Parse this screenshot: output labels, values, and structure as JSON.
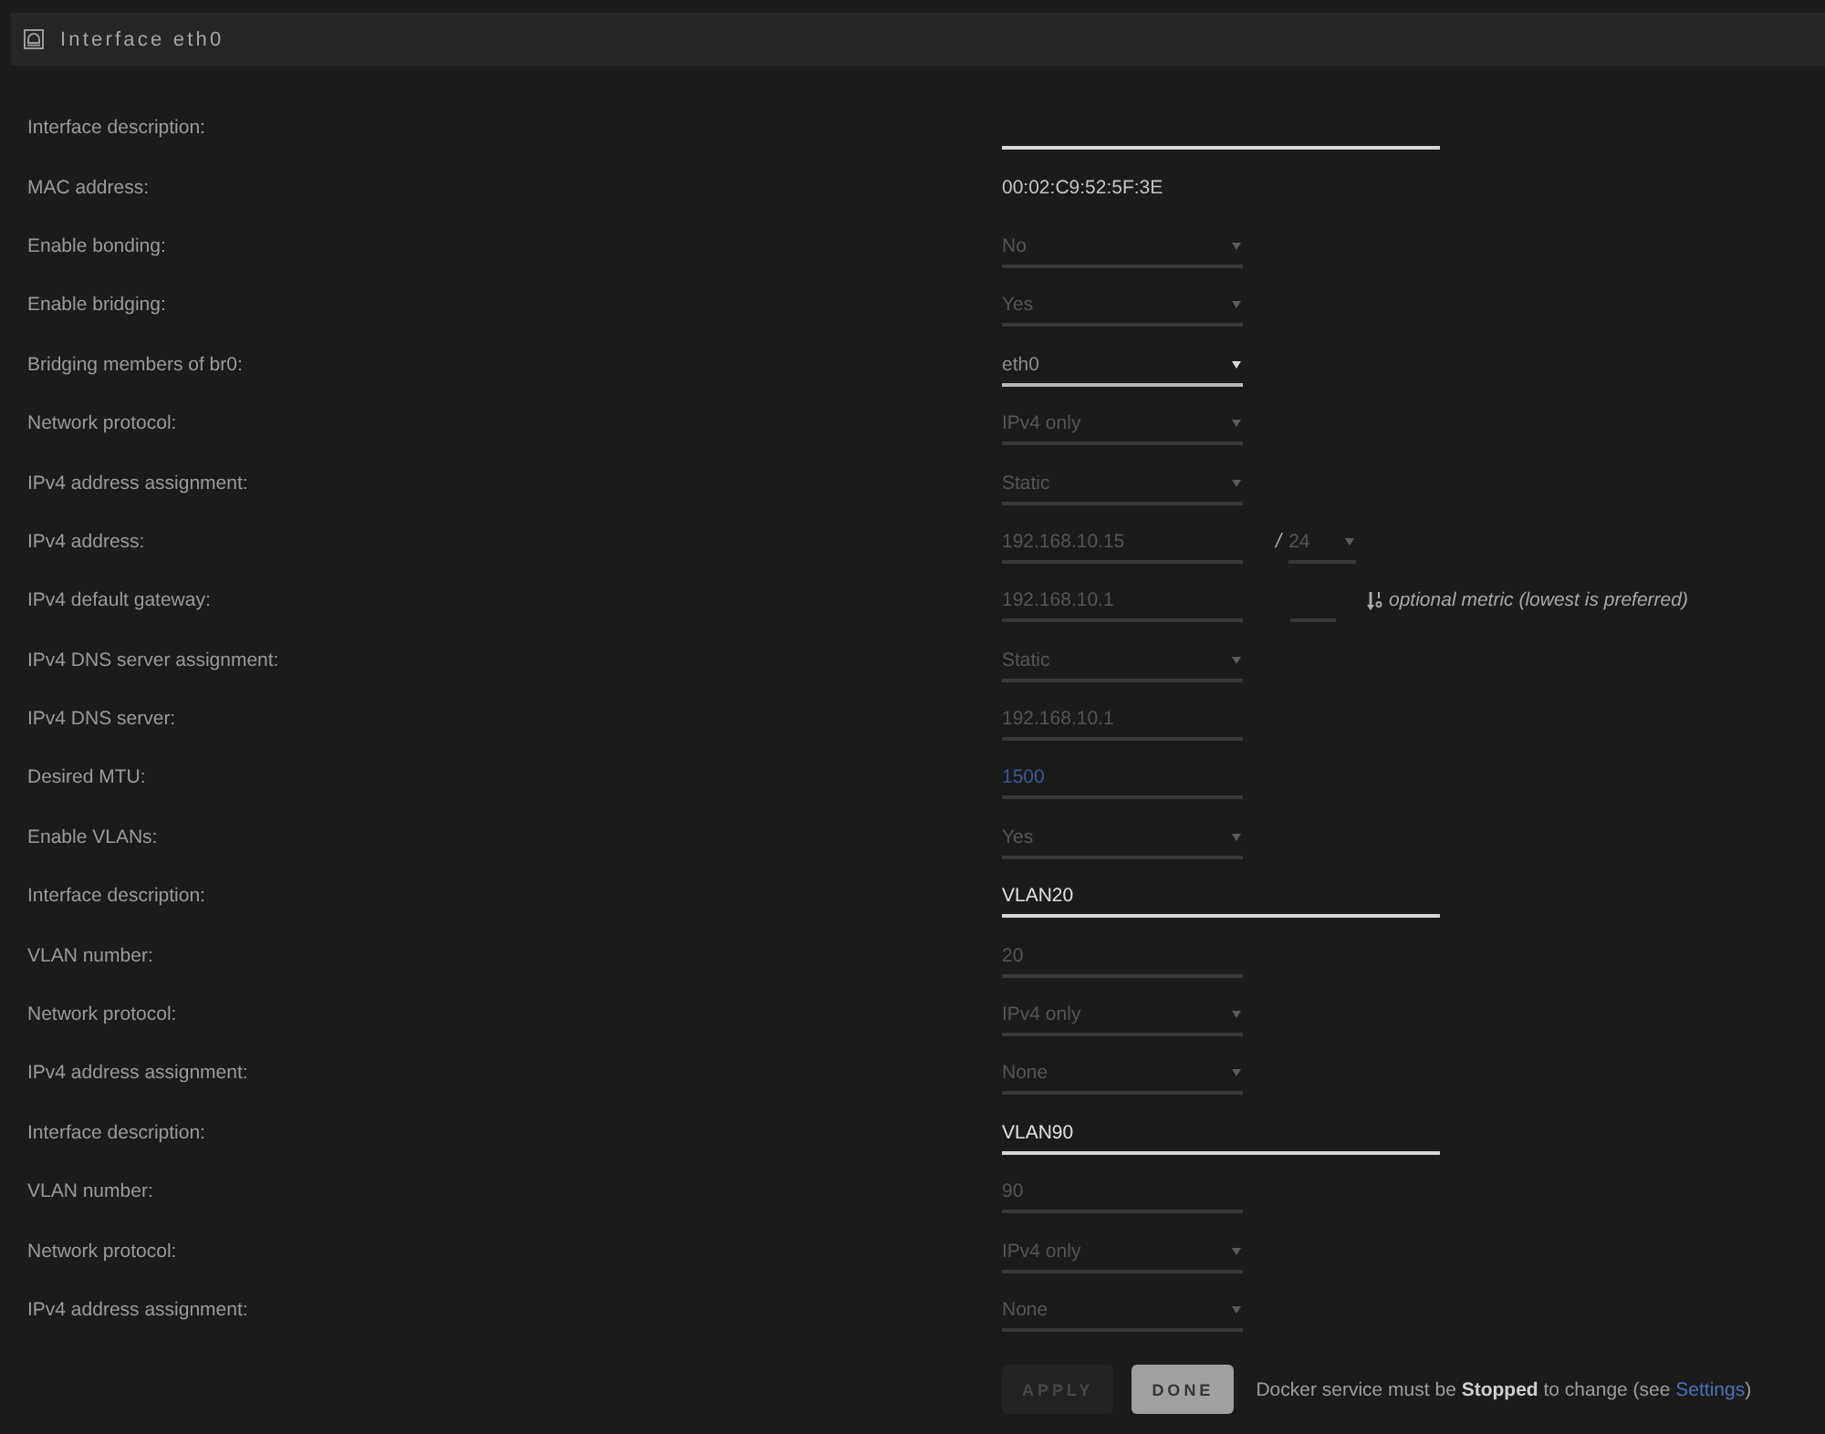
{
  "panel": {
    "title": "Interface eth0"
  },
  "rows": [
    {
      "label": "Interface description:",
      "field": {
        "kind": "text",
        "disabled": false
      }
    },
    {
      "label": "MAC address:",
      "field": {
        "kind": "static",
        "value": "00:02:C9:52:5F:3E"
      }
    },
    {
      "label": "Enable bonding:",
      "field": {
        "kind": "select",
        "value": "No",
        "disabled": true
      }
    },
    {
      "label": "Enable bridging:",
      "field": {
        "kind": "select",
        "value": "Yes",
        "disabled": true
      }
    },
    {
      "label": "Bridging members of br0:",
      "field": {
        "kind": "select",
        "value": "eth0",
        "disabled": false
      }
    },
    {
      "label": "Network protocol:",
      "field": {
        "kind": "select",
        "value": "IPv4 only",
        "disabled": true
      }
    },
    {
      "label": "IPv4 address assignment:",
      "field": {
        "kind": "select",
        "value": "Static",
        "disabled": true
      }
    },
    {
      "label": "IPv4 address:",
      "field": {
        "kind": "input",
        "value": "192.168.10.15",
        "disabled": true
      },
      "extra": {
        "kind": "netmask",
        "separator": "/",
        "value": "24",
        "disabled": true
      }
    },
    {
      "label": "IPv4 default gateway:",
      "field": {
        "kind": "input",
        "value": "192.168.10.1",
        "disabled": true
      },
      "extra": {
        "kind": "metric",
        "disabled": true,
        "hint": "optional metric (lowest is preferred)"
      }
    },
    {
      "label": "IPv4 DNS server assignment:",
      "field": {
        "kind": "select",
        "value": "Static",
        "disabled": true
      }
    },
    {
      "label": "IPv4 DNS server:",
      "field": {
        "kind": "input",
        "value": "192.168.10.1",
        "disabled": true
      }
    },
    {
      "label": "Desired MTU:",
      "field": {
        "kind": "input",
        "placeholder": "1500",
        "disabled": true
      }
    },
    {
      "label": "Enable VLANs:",
      "field": {
        "kind": "select",
        "value": "Yes",
        "disabled": true
      }
    },
    {
      "label": "Interface description:",
      "field": {
        "kind": "text",
        "value": "VLAN20",
        "disabled": false
      }
    },
    {
      "label": "VLAN number:",
      "field": {
        "kind": "input",
        "value": "20",
        "disabled": true
      }
    },
    {
      "label": "Network protocol:",
      "field": {
        "kind": "select",
        "value": "IPv4 only",
        "disabled": true
      }
    },
    {
      "label": "IPv4 address assignment:",
      "field": {
        "kind": "select",
        "value": "None",
        "disabled": true
      }
    },
    {
      "label": "Interface description:",
      "field": {
        "kind": "text",
        "value": "VLAN90",
        "disabled": false
      }
    },
    {
      "label": "VLAN number:",
      "field": {
        "kind": "input",
        "value": "90",
        "disabled": true
      }
    },
    {
      "label": "Network protocol:",
      "field": {
        "kind": "select",
        "value": "IPv4 only",
        "disabled": true
      }
    },
    {
      "label": "IPv4 address assignment:",
      "field": {
        "kind": "select",
        "value": "None",
        "disabled": true
      }
    }
  ],
  "footer": {
    "buttons": [
      {
        "label": "APPLY",
        "disabled": true
      },
      {
        "label": "DONE",
        "disabled": false
      }
    ],
    "note": {
      "text": "Docker service must be **Stopped** to change (see ",
      "link": "Settings",
      "end": ")"
    }
  }
}
